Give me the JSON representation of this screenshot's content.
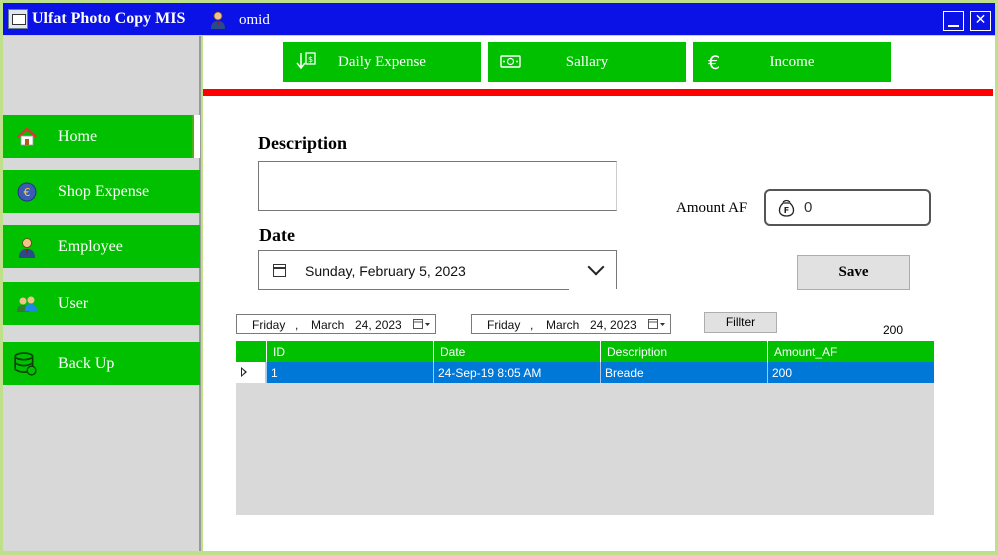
{
  "window": {
    "title": "Ulfat Photo Copy MIS",
    "user": "omid"
  },
  "sidebar": {
    "items": [
      {
        "label": "Home",
        "icon": "home-icon",
        "active": true
      },
      {
        "label": "Shop Expense",
        "icon": "euro-icon",
        "active": false
      },
      {
        "label": "Employee",
        "icon": "employee-icon",
        "active": false
      },
      {
        "label": "User",
        "icon": "users-icon",
        "active": false
      },
      {
        "label": "Back Up",
        "icon": "database-icon",
        "active": false
      }
    ]
  },
  "tabs": [
    {
      "label": "Daily Expense",
      "icon": "download-dollar-icon"
    },
    {
      "label": "Sallary",
      "icon": "money-icon"
    },
    {
      "label": "Income",
      "icon": "euro-icon"
    }
  ],
  "form": {
    "description_label": "Description",
    "description_value": "",
    "date_label": "Date",
    "date_value": "Sunday, February 5, 2023",
    "amount_label": "Amount AF",
    "amount_value": "0",
    "save_label": "Save"
  },
  "filter": {
    "from": {
      "day": "Friday",
      "sep": ",",
      "month": "March",
      "date": "24, 2023"
    },
    "to": {
      "day": "Friday",
      "sep": ",",
      "month": "March",
      "date": "24, 2023"
    },
    "button_label": "Fillter",
    "total": "200"
  },
  "table": {
    "columns": [
      "ID",
      "Date",
      "Description",
      "Amount_AF"
    ],
    "rows": [
      [
        "1",
        "24-Sep-19 8:05 AM",
        "Breade",
        "200"
      ]
    ]
  },
  "colors": {
    "titlebar": "#0a12e6",
    "accent": "#00c000",
    "divider": "#ff0000",
    "selection": "#0078d7"
  }
}
